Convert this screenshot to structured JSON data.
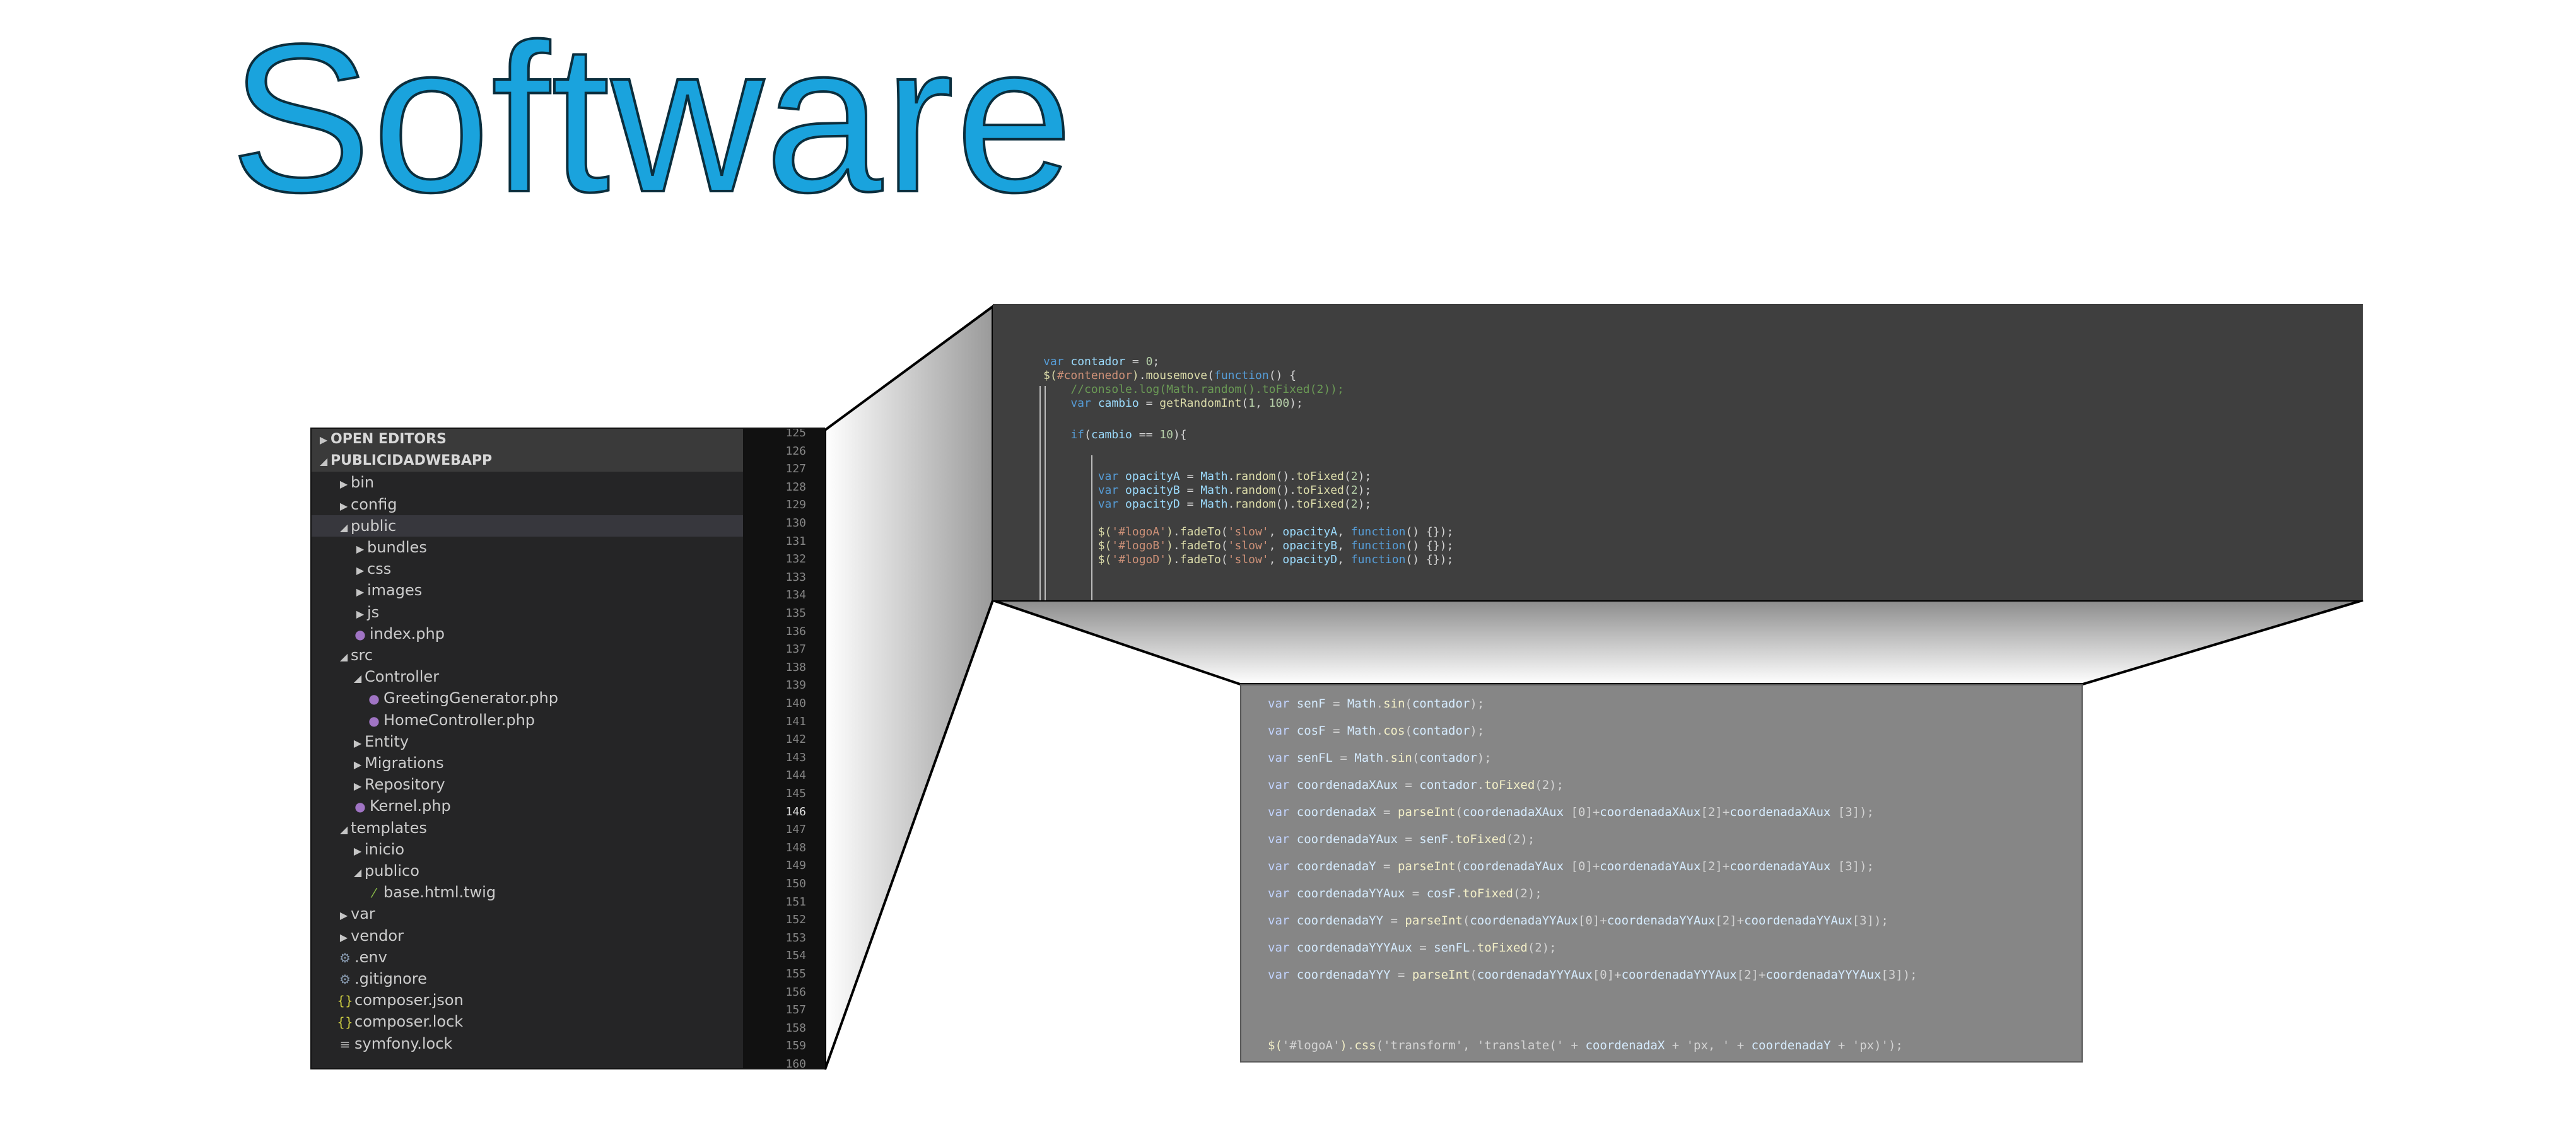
{
  "title": "Software",
  "colors": {
    "title_fill": "#1aa3dd",
    "title_outline": "#0b2e3d",
    "explorer_bg": "#252526",
    "gutter_bg": "#111111",
    "code_top_bg": "#3f3f3f",
    "code_bottom_bg": "#868686"
  },
  "explorer": {
    "items": [
      {
        "label": "OPEN EDITORS",
        "arrow": "▶",
        "icon": "",
        "kind": "header"
      },
      {
        "label": "PUBLICIDADWEBAPP",
        "arrow": "◢",
        "icon": "",
        "kind": "header"
      },
      {
        "label": "bin",
        "arrow": "▶",
        "icon": "",
        "kind": "folder"
      },
      {
        "label": "config",
        "arrow": "▶",
        "icon": "",
        "kind": "folder"
      },
      {
        "label": "public",
        "arrow": "◢",
        "icon": "",
        "kind": "folder",
        "selected": true
      },
      {
        "label": "bundles",
        "arrow": "▶",
        "icon": "",
        "kind": "folder"
      },
      {
        "label": "css",
        "arrow": "▶",
        "icon": "",
        "kind": "folder"
      },
      {
        "label": "images",
        "arrow": "▶",
        "icon": "",
        "kind": "folder"
      },
      {
        "label": "js",
        "arrow": "▶",
        "icon": "",
        "kind": "folder"
      },
      {
        "label": "index.php",
        "arrow": "",
        "icon": "php",
        "kind": "file"
      },
      {
        "label": "src",
        "arrow": "◢",
        "icon": "",
        "kind": "folder"
      },
      {
        "label": "Controller",
        "arrow": "◢",
        "icon": "",
        "kind": "folder"
      },
      {
        "label": "GreetingGenerator.php",
        "arrow": "",
        "icon": "php",
        "kind": "file"
      },
      {
        "label": "HomeController.php",
        "arrow": "",
        "icon": "php",
        "kind": "file"
      },
      {
        "label": "Entity",
        "arrow": "▶",
        "icon": "",
        "kind": "folder"
      },
      {
        "label": "Migrations",
        "arrow": "▶",
        "icon": "",
        "kind": "folder"
      },
      {
        "label": "Repository",
        "arrow": "▶",
        "icon": "",
        "kind": "folder"
      },
      {
        "label": "Kernel.php",
        "arrow": "",
        "icon": "php",
        "kind": "file"
      },
      {
        "label": "templates",
        "arrow": "◢",
        "icon": "",
        "kind": "folder"
      },
      {
        "label": "inicio",
        "arrow": "▶",
        "icon": "",
        "kind": "folder"
      },
      {
        "label": "publico",
        "arrow": "◢",
        "icon": "",
        "kind": "folder"
      },
      {
        "label": "base.html.twig",
        "arrow": "",
        "icon": "twig",
        "kind": "file"
      },
      {
        "label": "var",
        "arrow": "▶",
        "icon": "",
        "kind": "folder"
      },
      {
        "label": "vendor",
        "arrow": "▶",
        "icon": "",
        "kind": "folder"
      },
      {
        "label": ".env",
        "arrow": "",
        "icon": "env",
        "kind": "file"
      },
      {
        "label": ".gitignore",
        "arrow": "",
        "icon": "env",
        "kind": "file"
      },
      {
        "label": "composer.json",
        "arrow": "",
        "icon": "json",
        "kind": "file"
      },
      {
        "label": "composer.lock",
        "arrow": "",
        "icon": "json",
        "kind": "file"
      },
      {
        "label": "symfony.lock",
        "arrow": "",
        "icon": "lock",
        "kind": "file"
      }
    ],
    "line_numbers": [
      "125",
      "126",
      "127",
      "128",
      "129",
      "130",
      "131",
      "132",
      "133",
      "134",
      "135",
      "136",
      "137",
      "138",
      "139",
      "140",
      "141",
      "142",
      "143",
      "144",
      "145",
      "146",
      "147",
      "148",
      "149",
      "150",
      "151",
      "152",
      "153",
      "154",
      "155",
      "156",
      "157",
      "158",
      "159",
      "160"
    ],
    "active_line": "146"
  },
  "code_top": [
    [
      [
        "kw",
        "var "
      ],
      [
        "var",
        "contador"
      ],
      [
        "txt",
        " = "
      ],
      [
        "num",
        "0"
      ],
      [
        "txt",
        ";"
      ]
    ],
    [
      [
        "fn",
        "$("
      ],
      [
        "str",
        "#contenedor"
      ],
      [
        "fn",
        ")"
      ],
      [
        "txt",
        "."
      ],
      [
        "fn",
        "mousemove"
      ],
      [
        "txt",
        "("
      ],
      [
        "kw",
        "function"
      ],
      [
        "txt",
        "() {"
      ]
    ],
    [
      [
        "cmt",
        "    //console.log(Math.random().toFixed(2));"
      ]
    ],
    [
      [
        "kw",
        "    var "
      ],
      [
        "var",
        "cambio"
      ],
      [
        "txt",
        " = "
      ],
      [
        "fn",
        "getRandomInt"
      ],
      [
        "txt",
        "("
      ],
      [
        "num",
        "1"
      ],
      [
        "txt",
        ", "
      ],
      [
        "num",
        "100"
      ],
      [
        "txt",
        ");"
      ]
    ],
    [
      [
        "txt",
        ""
      ]
    ],
    [
      [
        "kw",
        "    if"
      ],
      [
        "txt",
        "("
      ],
      [
        "var",
        "cambio"
      ],
      [
        "txt",
        " == "
      ],
      [
        "num",
        "10"
      ],
      [
        "txt",
        "){"
      ]
    ],
    [
      [
        "txt",
        ""
      ]
    ],
    [
      [
        "kw",
        "        var "
      ],
      [
        "var",
        "opacityA"
      ],
      [
        "txt",
        " = "
      ],
      [
        "var",
        "Math"
      ],
      [
        "txt",
        "."
      ],
      [
        "fn",
        "random"
      ],
      [
        "txt",
        "()."
      ],
      [
        "fn",
        "toFixed"
      ],
      [
        "txt",
        "("
      ],
      [
        "num",
        "2"
      ],
      [
        "txt",
        ");"
      ]
    ],
    [
      [
        "kw",
        "        var "
      ],
      [
        "var",
        "opacityB"
      ],
      [
        "txt",
        " = "
      ],
      [
        "var",
        "Math"
      ],
      [
        "txt",
        "."
      ],
      [
        "fn",
        "random"
      ],
      [
        "txt",
        "()."
      ],
      [
        "fn",
        "toFixed"
      ],
      [
        "txt",
        "("
      ],
      [
        "num",
        "2"
      ],
      [
        "txt",
        ");"
      ]
    ],
    [
      [
        "kw",
        "        var "
      ],
      [
        "var",
        "opacityD"
      ],
      [
        "txt",
        " = "
      ],
      [
        "var",
        "Math"
      ],
      [
        "txt",
        "."
      ],
      [
        "fn",
        "random"
      ],
      [
        "txt",
        "()."
      ],
      [
        "fn",
        "toFixed"
      ],
      [
        "txt",
        "("
      ],
      [
        "num",
        "2"
      ],
      [
        "txt",
        ");"
      ]
    ],
    [
      [
        "txt",
        ""
      ]
    ],
    [
      [
        "fn",
        "        $("
      ],
      [
        "str",
        "'#logoA'"
      ],
      [
        "fn",
        ")"
      ],
      [
        "txt",
        "."
      ],
      [
        "fn",
        "fadeTo"
      ],
      [
        "txt",
        "("
      ],
      [
        "str",
        "'slow'"
      ],
      [
        "txt",
        ", "
      ],
      [
        "var",
        "opacityA"
      ],
      [
        "txt",
        ", "
      ],
      [
        "kw",
        "function"
      ],
      [
        "txt",
        "() {});"
      ]
    ],
    [
      [
        "fn",
        "        $("
      ],
      [
        "str",
        "'#logoB'"
      ],
      [
        "fn",
        ")"
      ],
      [
        "txt",
        "."
      ],
      [
        "fn",
        "fadeTo"
      ],
      [
        "txt",
        "("
      ],
      [
        "str",
        "'slow'"
      ],
      [
        "txt",
        ", "
      ],
      [
        "var",
        "opacityB"
      ],
      [
        "txt",
        ", "
      ],
      [
        "kw",
        "function"
      ],
      [
        "txt",
        "() {});"
      ]
    ],
    [
      [
        "fn",
        "        $("
      ],
      [
        "str",
        "'#logoD'"
      ],
      [
        "fn",
        ")"
      ],
      [
        "txt",
        "."
      ],
      [
        "fn",
        "fadeTo"
      ],
      [
        "txt",
        "("
      ],
      [
        "str",
        "'slow'"
      ],
      [
        "txt",
        ", "
      ],
      [
        "var",
        "opacityD"
      ],
      [
        "txt",
        ", "
      ],
      [
        "kw",
        "function"
      ],
      [
        "txt",
        "() {});"
      ]
    ]
  ],
  "code_bottom": [
    [
      [
        "kw2",
        "var "
      ],
      [
        "var2",
        "senF"
      ],
      [
        "txt",
        " = "
      ],
      [
        "var2",
        "Math"
      ],
      [
        "txt",
        "."
      ],
      [
        "fn2",
        "sin"
      ],
      [
        "txt",
        "("
      ],
      [
        "var2",
        "contador"
      ],
      [
        "txt",
        ");"
      ]
    ],
    [
      [
        "kw2",
        "var "
      ],
      [
        "var2",
        "cosF"
      ],
      [
        "txt",
        " = "
      ],
      [
        "var2",
        "Math"
      ],
      [
        "txt",
        "."
      ],
      [
        "fn2",
        "cos"
      ],
      [
        "txt",
        "("
      ],
      [
        "var2",
        "contador"
      ],
      [
        "txt",
        ");"
      ]
    ],
    [
      [
        "kw2",
        "var "
      ],
      [
        "var2",
        "senFL"
      ],
      [
        "txt",
        " = "
      ],
      [
        "var2",
        "Math"
      ],
      [
        "txt",
        "."
      ],
      [
        "fn2",
        "sin"
      ],
      [
        "txt",
        "("
      ],
      [
        "var2",
        "contador"
      ],
      [
        "txt",
        ");"
      ]
    ],
    [
      [
        "kw2",
        "var "
      ],
      [
        "var2",
        "coordenadaXAux"
      ],
      [
        "txt",
        " = "
      ],
      [
        "var2",
        "contador"
      ],
      [
        "txt",
        "."
      ],
      [
        "fn2",
        "toFixed"
      ],
      [
        "txt",
        "(2);"
      ]
    ],
    [
      [
        "kw2",
        "var "
      ],
      [
        "var2",
        "coordenadaX"
      ],
      [
        "txt",
        " = "
      ],
      [
        "fn2",
        "parseInt"
      ],
      [
        "txt",
        "("
      ],
      [
        "var2",
        "coordenadaXAux"
      ],
      [
        "txt",
        " [0]+"
      ],
      [
        "var2",
        "coordenadaXAux"
      ],
      [
        "txt",
        "[2]+"
      ],
      [
        "var2",
        "coordenadaXAux"
      ],
      [
        "txt",
        " [3]);"
      ]
    ],
    [
      [
        "kw2",
        "var "
      ],
      [
        "var2",
        "coordenadaYAux"
      ],
      [
        "txt",
        " = "
      ],
      [
        "var2",
        "senF"
      ],
      [
        "txt",
        "."
      ],
      [
        "fn2",
        "toFixed"
      ],
      [
        "txt",
        "(2);"
      ]
    ],
    [
      [
        "kw2",
        "var "
      ],
      [
        "var2",
        "coordenadaY"
      ],
      [
        "txt",
        " = "
      ],
      [
        "fn2",
        "parseInt"
      ],
      [
        "txt",
        "("
      ],
      [
        "var2",
        "coordenadaYAux"
      ],
      [
        "txt",
        " [0]+"
      ],
      [
        "var2",
        "coordenadaYAux"
      ],
      [
        "txt",
        "[2]+"
      ],
      [
        "var2",
        "coordenadaYAux"
      ],
      [
        "txt",
        " [3]);"
      ]
    ],
    [
      [
        "kw2",
        "var "
      ],
      [
        "var2",
        "coordenadaYYAux"
      ],
      [
        "txt",
        " = "
      ],
      [
        "var2",
        "cosF"
      ],
      [
        "txt",
        "."
      ],
      [
        "fn2",
        "toFixed"
      ],
      [
        "txt",
        "(2);"
      ]
    ],
    [
      [
        "kw2",
        "var "
      ],
      [
        "var2",
        "coordenadaYY"
      ],
      [
        "txt",
        " = "
      ],
      [
        "fn2",
        "parseInt"
      ],
      [
        "txt",
        "("
      ],
      [
        "var2",
        "coordenadaYYAux"
      ],
      [
        "txt",
        "[0]+"
      ],
      [
        "var2",
        "coordenadaYYAux"
      ],
      [
        "txt",
        "[2]+"
      ],
      [
        "var2",
        "coordenadaYYAux"
      ],
      [
        "txt",
        "[3]);"
      ]
    ],
    [
      [
        "kw2",
        "var "
      ],
      [
        "var2",
        "coordenadaYYYAux"
      ],
      [
        "txt",
        " = "
      ],
      [
        "var2",
        "senFL"
      ],
      [
        "txt",
        "."
      ],
      [
        "fn2",
        "toFixed"
      ],
      [
        "txt",
        "(2);"
      ]
    ],
    [
      [
        "kw2",
        "var "
      ],
      [
        "var2",
        "coordenadaYYY"
      ],
      [
        "txt",
        " = "
      ],
      [
        "fn2",
        "parseInt"
      ],
      [
        "txt",
        "("
      ],
      [
        "var2",
        "coordenadaYYYAux"
      ],
      [
        "txt",
        "[0]+"
      ],
      [
        "var2",
        "coordenadaYYYAux"
      ],
      [
        "txt",
        "[2]+"
      ],
      [
        "var2",
        "coordenadaYYYAux"
      ],
      [
        "txt",
        "[3]);"
      ]
    ],
    [
      [
        "txt",
        ""
      ]
    ],
    [
      [
        "txt",
        ""
      ]
    ],
    [
      [
        "fn2",
        "$("
      ],
      [
        "txt",
        "'#logoA'"
      ],
      [
        "fn2",
        ")"
      ],
      [
        "txt",
        "."
      ],
      [
        "fn2",
        "css"
      ],
      [
        "txt",
        "("
      ],
      [
        "txt",
        "'transform'"
      ],
      [
        "txt",
        ", "
      ],
      [
        "txt",
        "'translate('"
      ],
      [
        "txt",
        " + "
      ],
      [
        "var2",
        "coordenadaX"
      ],
      [
        "txt",
        " + "
      ],
      [
        "txt",
        "'px, '"
      ],
      [
        "txt",
        " + "
      ],
      [
        "var2",
        "coordenadaY"
      ],
      [
        "txt",
        " + "
      ],
      [
        "txt",
        "'px)'"
      ],
      [
        "txt",
        ");"
      ]
    ]
  ]
}
